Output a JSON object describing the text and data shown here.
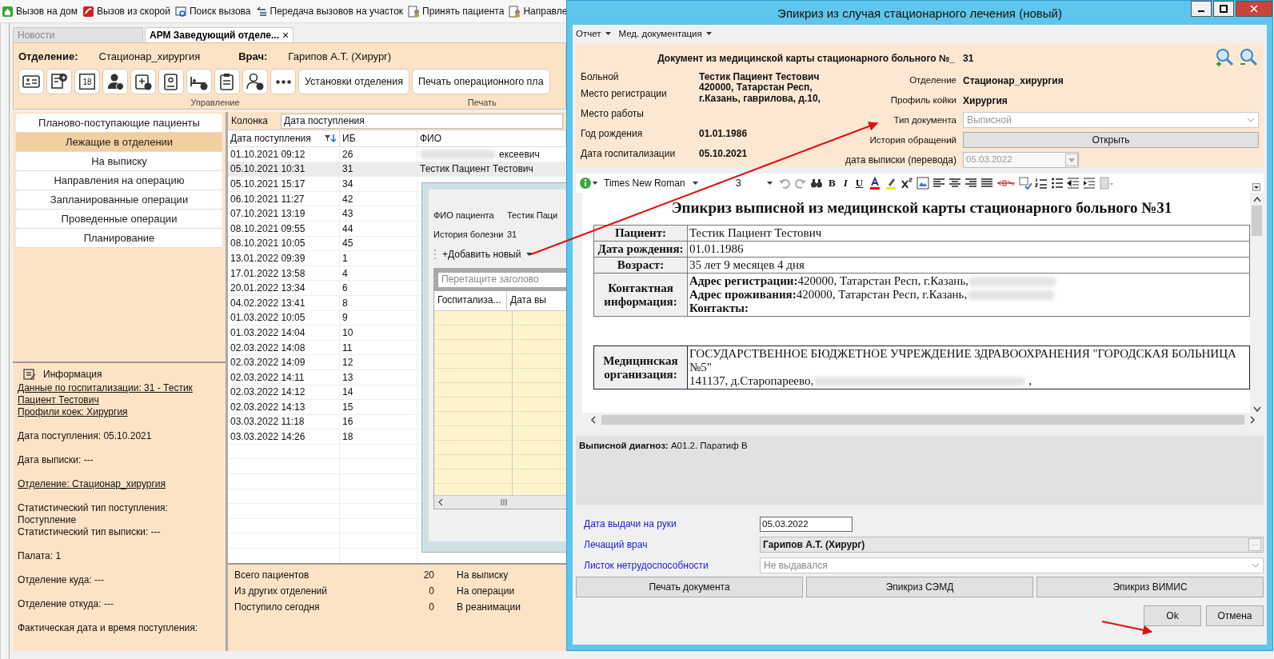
{
  "toolbar": [
    {
      "kind": "home",
      "label": "Вызов на дом"
    },
    {
      "kind": "ambulance",
      "label": "Вызов из скорой"
    },
    {
      "kind": "search",
      "label": "Поиск вызова"
    },
    {
      "kind": "transfer",
      "label": "Передача вызовов на участок"
    },
    {
      "kind": "accept",
      "label": "Принять пациента"
    },
    {
      "kind": "accept",
      "label": "Направле"
    }
  ],
  "tabs": [
    {
      "label": "Новости",
      "selected": false
    },
    {
      "label": "АРМ Заведующий отделе...",
      "selected": true,
      "close": "×"
    }
  ],
  "header": {
    "department_label": "Отделение:",
    "department": "Стационар_хирургия",
    "doctor_label": "Врач:",
    "doctor": "Гарипов А.Т. (Хирург)"
  },
  "ribbon": [
    {
      "label": "Управление",
      "items": [
        {
          "kind": "card"
        },
        {
          "kind": "document"
        },
        {
          "kind": "calendar",
          "text": "18"
        },
        {
          "kind": "doctor"
        },
        {
          "kind": "kit"
        },
        {
          "kind": "badge"
        },
        {
          "kind": "bed"
        },
        {
          "kind": "clipboard"
        },
        {
          "kind": "person"
        },
        {
          "kind": "more"
        },
        {
          "kind": "text",
          "label": "Установки отделения"
        }
      ]
    },
    {
      "label": "Печать",
      "items": [
        {
          "kind": "text",
          "label": "Печать операционного пла"
        }
      ]
    }
  ],
  "nav": [
    {
      "label": "Планово-поступающие пациенты",
      "selected": false
    },
    {
      "label": "Лежащие в отделении",
      "selected": true
    },
    {
      "label": "На выписку",
      "selected": false
    },
    {
      "label": "Направления на операцию",
      "selected": false
    },
    {
      "label": "Запланированные операции",
      "selected": false
    },
    {
      "label": "Проведенные операции",
      "selected": false
    },
    {
      "label": "Планирование",
      "selected": false
    }
  ],
  "info": {
    "title": "Информация",
    "blocks": [
      [
        {
          "text": "Данные по госпитализации: 31 - Тестик Пациент Тестович",
          "link": true
        },
        {
          "text": "Профили коек: Хирургия",
          "link": true
        }
      ],
      [
        {
          "text": "Дата поступления: 05.10.2021",
          "link": false
        }
      ],
      [
        {
          "text": "Дата выписки: ---",
          "link": false
        }
      ],
      [
        {
          "text": "Отделение: Стационар_хирургия",
          "link": true
        }
      ],
      [
        {
          "text": "Статистический тип поступления: Поступление",
          "link": false
        },
        {
          "text": "Статистический тип выписки: ---",
          "link": false
        }
      ],
      [
        {
          "text": "Палата: 1",
          "link": false
        }
      ],
      [
        {
          "text": "Отделение куда: ---",
          "link": false
        }
      ],
      [
        {
          "text": "Отделение откуда: ---",
          "link": false
        }
      ],
      [
        {
          "text": "Фактическая дата и время поступления:",
          "link": false
        }
      ]
    ]
  },
  "grid": {
    "filter_label": "Колонка",
    "filter_value": "Дата поступления",
    "columns": [
      "Дата поступления",
      "ИБ",
      "ФИО"
    ],
    "rows": [
      {
        "date": "01.10.2021 09:12",
        "ib": "26",
        "fio": "ексеевич",
        "redacted": true,
        "selected": false
      },
      {
        "date": "05.10.2021 10:31",
        "ib": "31",
        "fio": "Тестик Пациент Тестович",
        "selected": true
      },
      {
        "date": "05.10.2021 15:17",
        "ib": "34",
        "selected": false
      },
      {
        "date": "06.10.2021 11:27",
        "ib": "42",
        "selected": false
      },
      {
        "date": "07.10.2021 13:19",
        "ib": "43",
        "selected": false
      },
      {
        "date": "08.10.2021 09:55",
        "ib": "44",
        "selected": false
      },
      {
        "date": "08.10.2021 10:05",
        "ib": "45",
        "selected": false
      },
      {
        "date": "13.01.2022 09:39",
        "ib": "1",
        "selected": false
      },
      {
        "date": "17.01.2022 13:58",
        "ib": "4",
        "selected": false
      },
      {
        "date": "20.01.2022 13:34",
        "ib": "6",
        "selected": false
      },
      {
        "date": "04.02.2022 13:41",
        "ib": "8",
        "selected": false
      },
      {
        "date": "01.03.2022 10:05",
        "ib": "9",
        "selected": false
      },
      {
        "date": "01.03.2022 14:04",
        "ib": "10",
        "selected": false
      },
      {
        "date": "02.03.2022 14:08",
        "ib": "11",
        "selected": false
      },
      {
        "date": "02.03.2022 14:09",
        "ib": "12",
        "selected": false
      },
      {
        "date": "02.03.2022 14:11",
        "ib": "13",
        "selected": false
      },
      {
        "date": "02.03.2022 14:12",
        "ib": "14",
        "selected": false
      },
      {
        "date": "02.03.2022 14:13",
        "ib": "15",
        "selected": false
      },
      {
        "date": "03.03.2022 11:18",
        "ib": "16",
        "selected": false
      },
      {
        "date": "03.03.2022 14:26",
        "ib": "18",
        "selected": false
      }
    ],
    "summary": [
      {
        "label": "Всего пациентов",
        "value": "20",
        "label2": "На выписку"
      },
      {
        "label": "Из других отделений",
        "value": "0",
        "label2": "На операции"
      },
      {
        "label": "Поступило сегодня",
        "value": "0",
        "label2": "В реанимации"
      }
    ]
  },
  "history_dialog": {
    "fields": [
      {
        "label": "ФИО пациента",
        "value": "Тестик Паци"
      },
      {
        "label": "История болезни",
        "value": "31"
      }
    ],
    "add_button": "+Добавить новый",
    "group_panel": "Перетащите заголово",
    "columns": [
      "Госпитализа...",
      "Дата вы"
    ]
  },
  "dialog": {
    "title": "Эпикриз из случая стационарного лечения (новый)",
    "menu": [
      {
        "label": "Отчет"
      },
      {
        "label": "Мед. документация"
      }
    ],
    "doc_header": {
      "label": "Документ из медицинской карты стационарного больного №_",
      "value": "31"
    },
    "left_fields": [
      {
        "label": "Больной",
        "value": "Тестик Пациент Тестович"
      },
      {
        "label": "Место регистрации",
        "value": "420000, Татарстан Респ, г.Казань, гаврилова, д.10,"
      },
      {
        "label": "Место работы"
      },
      {
        "label": "Год рождения",
        "value": "01.01.1986"
      },
      {
        "label": "Дата госпитализации",
        "value": "05.10.2021"
      }
    ],
    "right_fields": [
      {
        "kind": "text",
        "label": "Отделение",
        "value": "Стационар_хирургия"
      },
      {
        "kind": "text",
        "label": "Профиль койки",
        "value": "Хирургия"
      },
      {
        "kind": "select",
        "label": "Тип документа",
        "value": "Выписной",
        "disabled": true
      },
      {
        "kind": "button",
        "label": "История обращений",
        "value": "Открыть"
      },
      {
        "kind": "date",
        "label": "дата выписки (перевода)",
        "value": "05.03.2022",
        "disabled": true
      }
    ],
    "editor": {
      "font": "Times New Roman",
      "size": "3",
      "tools": [
        {
          "kind": "undo"
        },
        {
          "kind": "redo"
        },
        {
          "kind": "find"
        },
        {
          "kind": "bold",
          "label": "B"
        },
        {
          "kind": "italic",
          "label": "I"
        },
        {
          "kind": "underline",
          "label": "U"
        },
        {
          "kind": "color"
        },
        {
          "kind": "highlight"
        },
        {
          "kind": "superscript"
        },
        {
          "kind": "image"
        },
        {
          "kind": "left"
        },
        {
          "kind": "center"
        },
        {
          "kind": "right"
        },
        {
          "kind": "justify"
        },
        {
          "kind": "br"
        },
        {
          "kind": "spell"
        },
        {
          "kind": "ordered"
        },
        {
          "kind": "bullets"
        },
        {
          "kind": "outdent"
        },
        {
          "kind": "indent"
        },
        {
          "kind": "page"
        }
      ]
    },
    "document": {
      "title": "Эпикриз выписной из медицинской карты стационарного больного №31",
      "patient_table": [
        {
          "label": "Пациент:",
          "lines": [
            {
              "text": "Тестик Пациент Тестович"
            }
          ]
        },
        {
          "label": "Дата рождения:",
          "lines": [
            {
              "text": "01.01.1986"
            }
          ]
        },
        {
          "label": "Возраст:",
          "lines": [
            {
              "text": "35 лет 9 месяцев 4 дня"
            }
          ]
        },
        {
          "label": "Контактная информация:",
          "lines": [
            {
              "text": "**Адрес регистрации:**420000, Татарстан Респ, г.Казань,",
              "redacted": true
            },
            {
              "text": "**Адрес проживания:**420000, Татарстан Респ, г.Казань,",
              "redacted": true
            },
            {
              "text": "Контакты:",
              "bold": true
            }
          ]
        }
      ],
      "org_table": [
        {
          "label": "Медицинская организация:",
          "lines": [
            {
              "text": "ГОСУДАРСТВЕННОЕ БЮДЖЕТНОЕ УЧРЕЖДЕНИЕ ЗДРАВООХРАНЕНИЯ \"ГОРОДСКАЯ БОЛЬНИЦА №5\""
            },
            {
              "text": "141137, д.Старопареево,",
              "redacted": true,
              "suffix": ","
            }
          ]
        }
      ]
    },
    "diagnosis": "**Выписной диагноз:** A01.2. Паратиф В",
    "bottom_fields": [
      {
        "kind": "date",
        "label": "Дата выдачи на руки",
        "value": "05.03.2022"
      },
      {
        "kind": "lookup",
        "label": "Лечащий врач",
        "value": "Гарипов А.Т. (Хирург)",
        "button": "..."
      },
      {
        "kind": "select",
        "label": "Листок нетрудоспособности",
        "value": "Не выдавался"
      }
    ],
    "actions": [
      "Печать документа",
      "Эпикриз СЭМД",
      "Эпикриз ВИМИС"
    ],
    "footer": [
      "Ok",
      "Отмена"
    ]
  }
}
